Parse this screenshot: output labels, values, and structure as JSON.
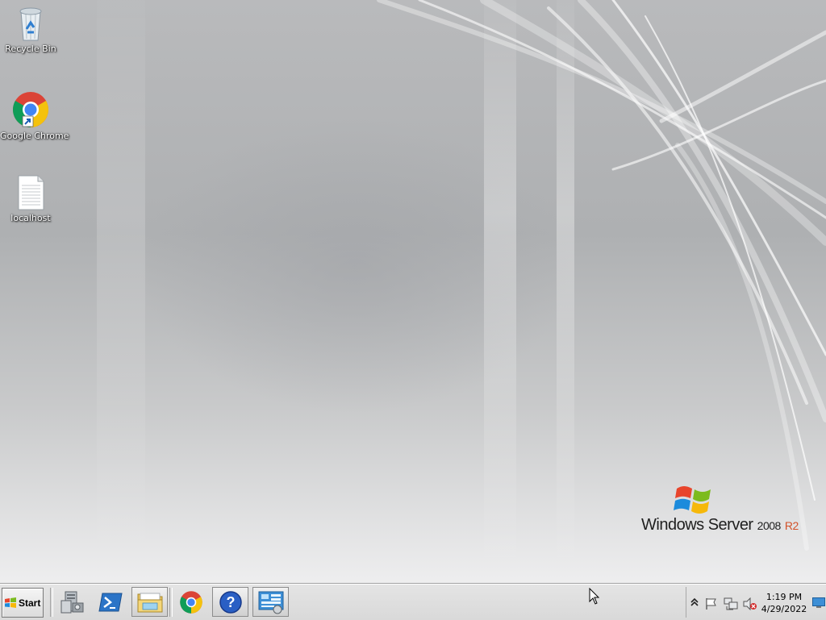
{
  "desktop": {
    "icons": [
      {
        "label": "Recycle Bin",
        "icon": "recycle-bin-icon"
      },
      {
        "label": "Google Chrome",
        "icon": "chrome-icon"
      },
      {
        "label": "localhost",
        "icon": "text-file-icon"
      }
    ],
    "branding": {
      "product": "Windows Server",
      "version": "2008",
      "release": "R2"
    }
  },
  "taskbar": {
    "start_label": "Start",
    "pinned": [
      {
        "name": "server-manager",
        "icon": "server-manager-icon"
      },
      {
        "name": "powershell",
        "icon": "powershell-icon"
      },
      {
        "name": "windows-explorer",
        "icon": "folder-icon"
      },
      {
        "name": "google-chrome",
        "icon": "chrome-icon"
      },
      {
        "name": "help",
        "icon": "help-icon"
      },
      {
        "name": "control-panel",
        "icon": "control-panel-icon"
      }
    ]
  },
  "tray": {
    "icons": [
      "show-hidden-icons",
      "action-center-flag-icon",
      "network-icon",
      "volume-muted-icon"
    ],
    "time": "1:19 PM",
    "date": "4/29/2022"
  },
  "colors": {
    "desktop_top": "#b9babc",
    "desktop_bottom": "#eeeeef",
    "taskbar": "#dcdcdc",
    "brand_accent": "#d2522a"
  }
}
